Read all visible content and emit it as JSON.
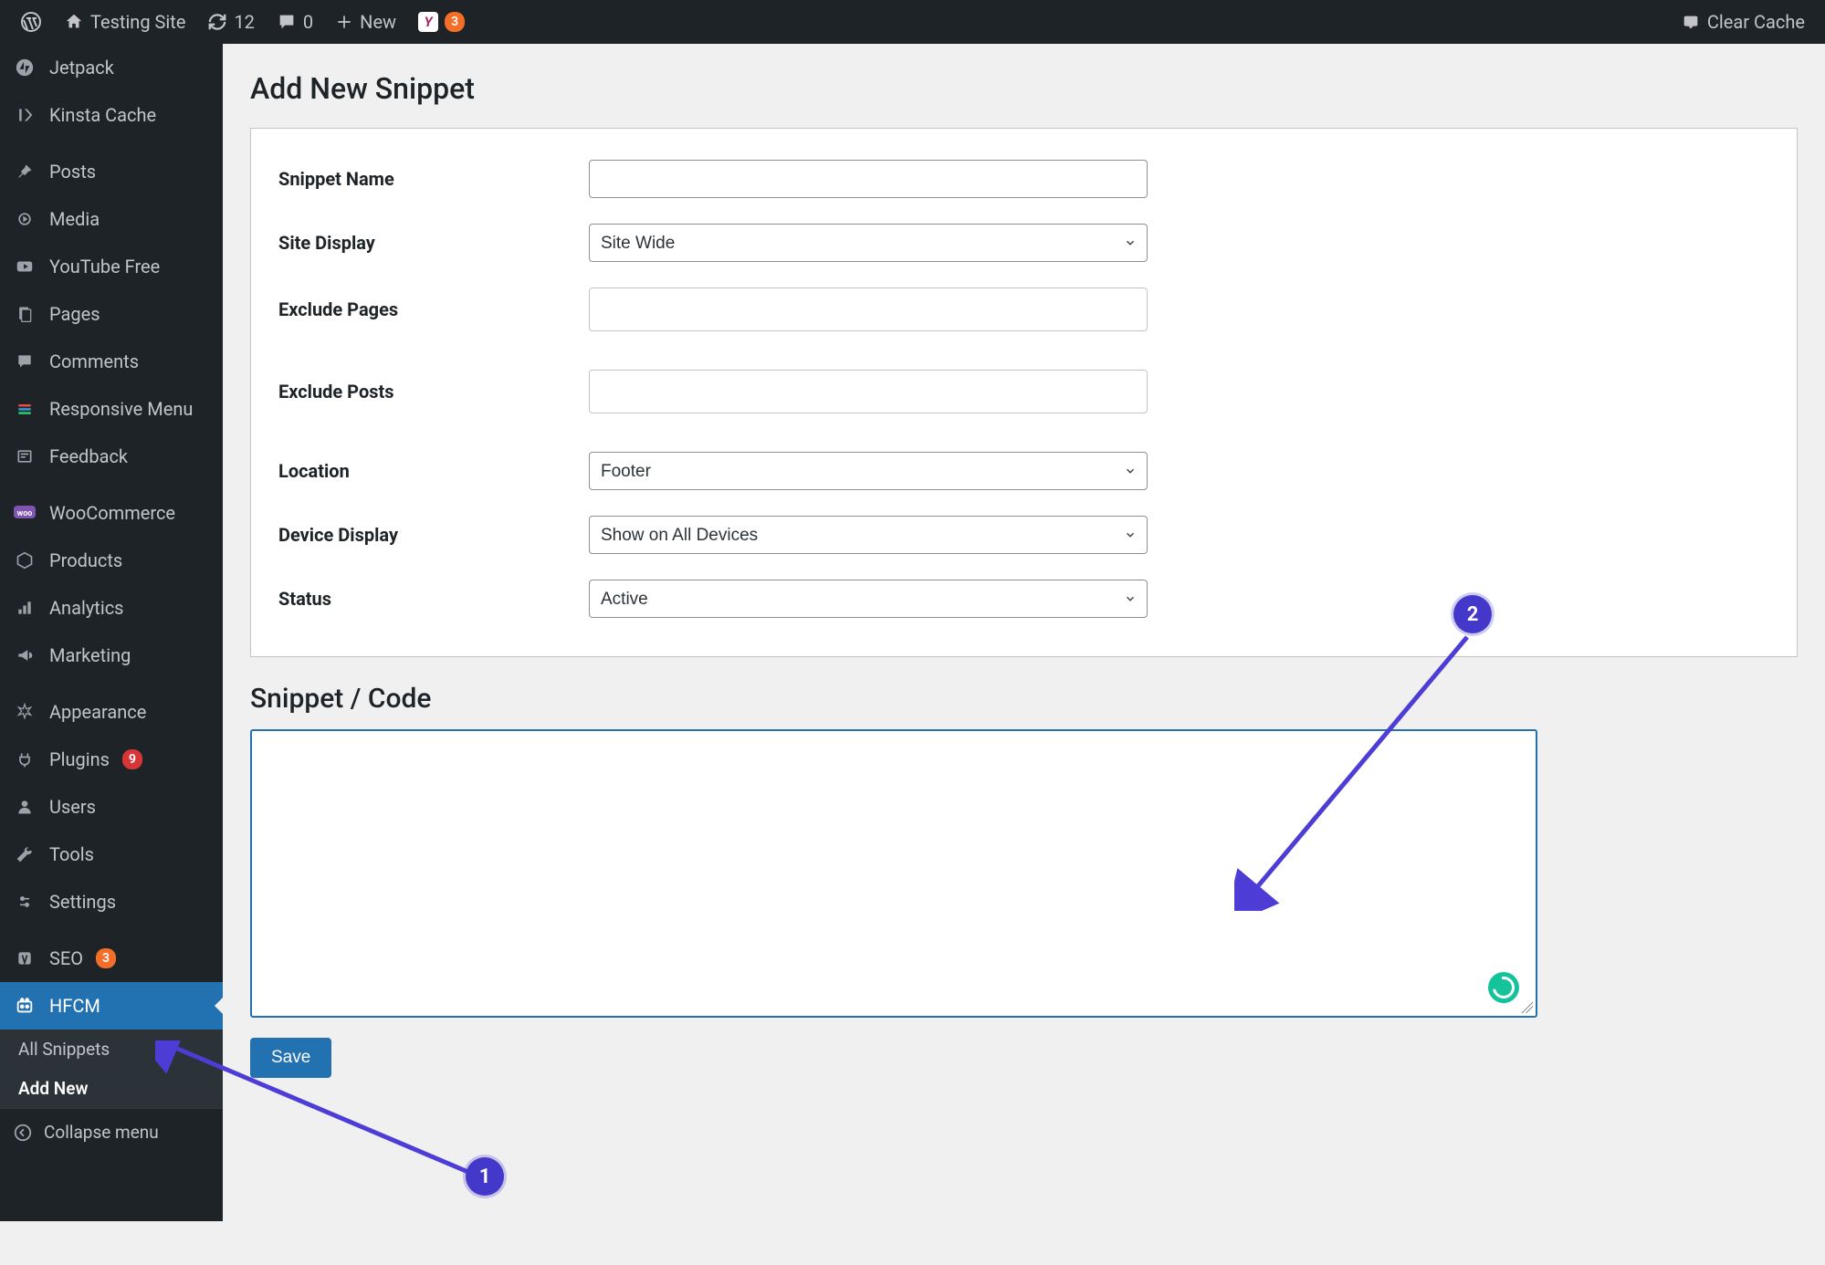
{
  "adminbar": {
    "site_name": "Testing Site",
    "updates_count": "12",
    "comments_count": "0",
    "new_label": "New",
    "yoast_badge": "3",
    "clear_cache": "Clear Cache"
  },
  "sidebar": {
    "items": [
      {
        "label": "Jetpack",
        "icon": "jetpack-icon"
      },
      {
        "label": "Kinsta Cache",
        "icon": "kinsta-icon"
      },
      {
        "label": "Posts",
        "icon": "pin-icon"
      },
      {
        "label": "Media",
        "icon": "media-icon"
      },
      {
        "label": "YouTube Free",
        "icon": "youtube-icon"
      },
      {
        "label": "Pages",
        "icon": "pages-icon"
      },
      {
        "label": "Comments",
        "icon": "comments-icon"
      },
      {
        "label": "Responsive Menu",
        "icon": "responsive-icon"
      },
      {
        "label": "Feedback",
        "icon": "feedback-icon"
      },
      {
        "label": "WooCommerce",
        "icon": "woo-icon"
      },
      {
        "label": "Products",
        "icon": "products-icon"
      },
      {
        "label": "Analytics",
        "icon": "analytics-icon"
      },
      {
        "label": "Marketing",
        "icon": "marketing-icon"
      },
      {
        "label": "Appearance",
        "icon": "appearance-icon"
      },
      {
        "label": "Plugins",
        "icon": "plugins-icon",
        "badge": "9",
        "badge_color": "red"
      },
      {
        "label": "Users",
        "icon": "users-icon"
      },
      {
        "label": "Tools",
        "icon": "tools-icon"
      },
      {
        "label": "Settings",
        "icon": "settings-icon"
      },
      {
        "label": "SEO",
        "icon": "seo-icon",
        "badge": "3",
        "badge_color": "orange"
      },
      {
        "label": "HFCM",
        "icon": "hfcm-icon",
        "active": true
      }
    ],
    "sub_items": [
      {
        "label": "All Snippets"
      },
      {
        "label": "Add New",
        "current": true
      }
    ],
    "collapse_label": "Collapse menu"
  },
  "page": {
    "title": "Add New Snippet",
    "fields": {
      "snippet_name_label": "Snippet Name",
      "snippet_name_value": "",
      "site_display_label": "Site Display",
      "site_display_value": "Site Wide",
      "exclude_pages_label": "Exclude Pages",
      "exclude_posts_label": "Exclude Posts",
      "location_label": "Location",
      "location_value": "Footer",
      "device_display_label": "Device Display",
      "device_display_value": "Show on All Devices",
      "status_label": "Status",
      "status_value": "Active"
    },
    "code_section_title": "Snippet / Code",
    "save_label": "Save"
  },
  "annotations": {
    "callout1": "1",
    "callout2": "2"
  }
}
